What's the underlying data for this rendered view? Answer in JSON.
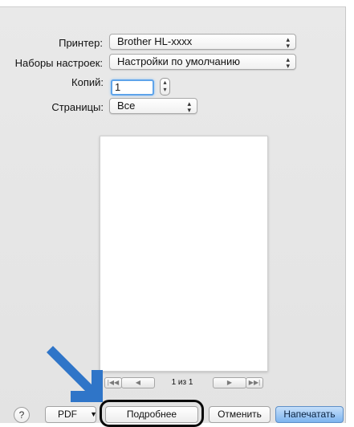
{
  "printer": {
    "label": "Принтер:",
    "value": "Brother HL-xxxx"
  },
  "presets": {
    "label": "Наборы настроек:",
    "value": "Настройки по умолчанию"
  },
  "copies": {
    "label": "Копий:",
    "value": "1"
  },
  "pages": {
    "label": "Страницы:",
    "value": "Все"
  },
  "preview": {
    "page_indicator": "1 из 1"
  },
  "footer": {
    "help_label": "?",
    "pdf_label": "PDF",
    "details_label": "Подробнее",
    "cancel_label": "Отменить",
    "print_label": "Напечатать"
  },
  "colors": {
    "dialog_bg": "#e6e6e6",
    "focus_ring": "#5fa4ea",
    "primary_button": "#7db4ef",
    "arrow": "#2f75c8"
  }
}
